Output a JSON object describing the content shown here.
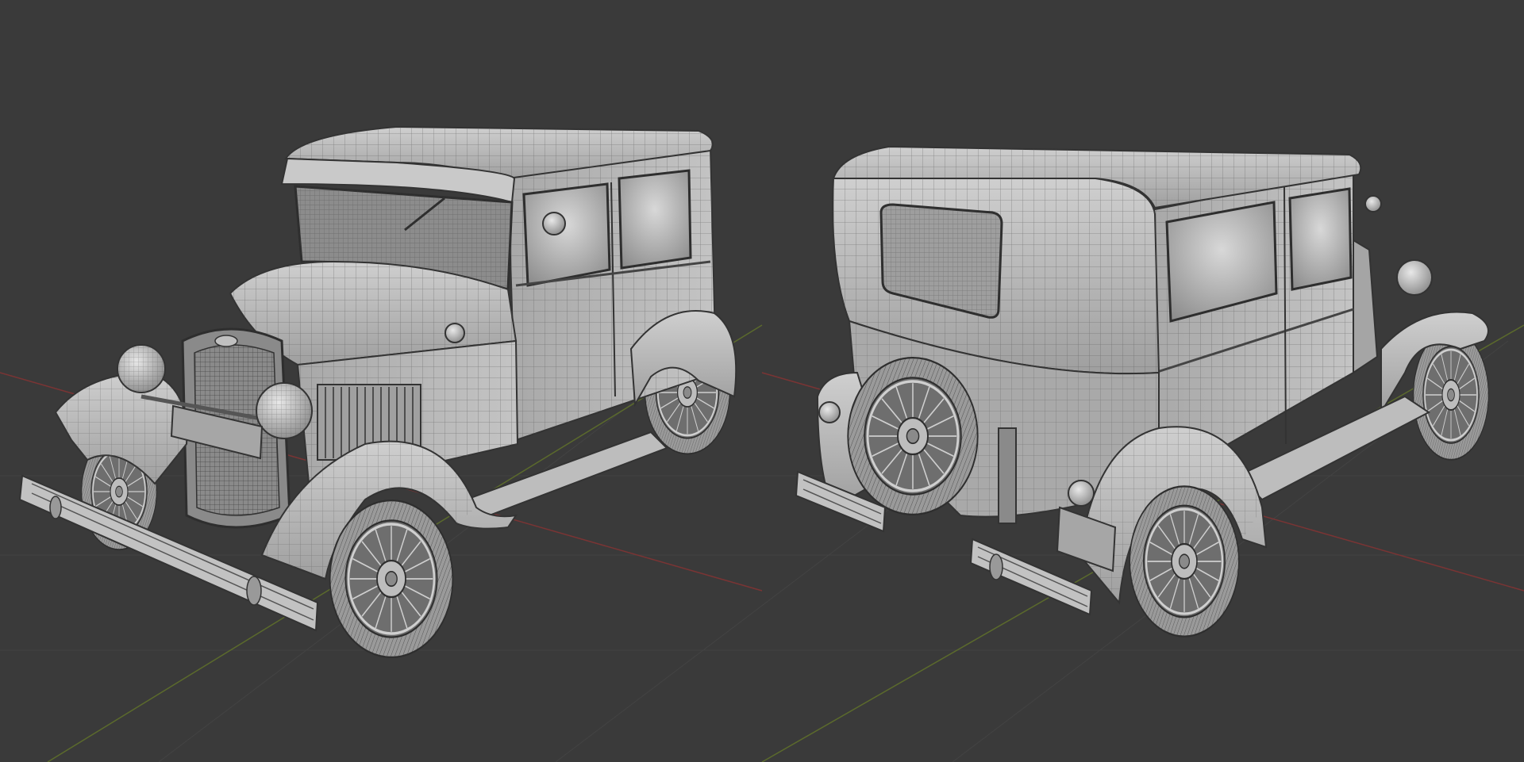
{
  "viewport": {
    "background_color": "#3a3a3a",
    "grid_color": "#424242",
    "x_axis_color": "#7a3434",
    "y_axis_color": "#5b6a2c"
  },
  "models": [
    {
      "name": "vintage-sedan",
      "view": "front-three-quarter",
      "mesh_color": "#b9b9b9",
      "wire_color": "#3e3e3e"
    },
    {
      "name": "vintage-sedan",
      "view": "rear-three-quarter",
      "mesh_color": "#b9b9b9",
      "wire_color": "#3e3e3e"
    }
  ]
}
